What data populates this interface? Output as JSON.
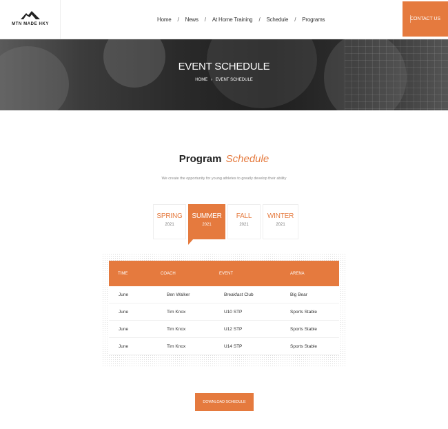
{
  "brand": {
    "logo_text": "MTN MADE HKY"
  },
  "nav": {
    "items": [
      {
        "label": "Home"
      },
      {
        "label": "News"
      },
      {
        "label": "At Home Training"
      },
      {
        "label": "Schedule"
      },
      {
        "label": "Programs"
      }
    ],
    "separator": "/"
  },
  "contact_label": "CONTACT US",
  "hero": {
    "title": "EVENT SCHEDULE",
    "breadcrumb": {
      "home": "HOME",
      "chevron": "›",
      "current": "EVENT SCHEDULE"
    }
  },
  "program": {
    "title_main": "Program",
    "title_accent": "Schedule",
    "subtitle": "We create the opportunity for young athletes to greatly develop their ability"
  },
  "tabs": [
    {
      "season": "SPRING",
      "year": "2021",
      "active": false
    },
    {
      "season": "SUMMER",
      "year": "2021",
      "active": true
    },
    {
      "season": "FALL",
      "year": "2021",
      "active": false
    },
    {
      "season": "WINTER",
      "year": "2021",
      "active": false
    }
  ],
  "table": {
    "headers": [
      "TIME",
      "COACH",
      "EVENT",
      "ARENA"
    ],
    "rows": [
      [
        "June",
        "Ben Walker",
        "Breakfast Club",
        "Big Bear"
      ],
      [
        "June",
        "Tim Knox",
        "U10 STP",
        "Sports Stable"
      ],
      [
        "June",
        "Tim Knox",
        "U12 STP",
        "Sports Stable"
      ],
      [
        "June",
        "Tim Knox",
        "U14 STP",
        "Sports Stable"
      ]
    ]
  },
  "download_label": "DOWNLOAD SCHEDULE",
  "colors": {
    "accent": "#e57a3e",
    "text": "#222222",
    "muted": "#888888"
  },
  "icons": {
    "logo": "mountain-icon",
    "breadcrumb": "chevron-right-icon"
  }
}
